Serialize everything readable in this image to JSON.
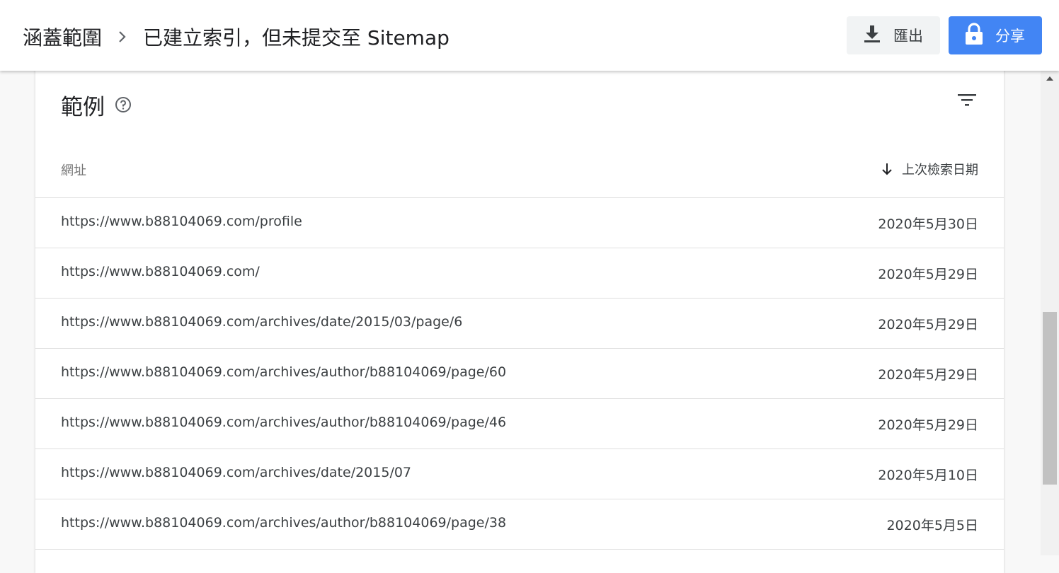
{
  "header": {
    "breadcrumb_parent": "涵蓋範圍",
    "breadcrumb_current": "已建立索引，但未提交至 Sitemap",
    "export_label": "匯出",
    "share_label": "分享",
    "share_color": "#4285f4"
  },
  "card": {
    "title": "範例",
    "columns": {
      "url": "網址",
      "date": "上次檢索日期"
    },
    "rows": [
      {
        "url": "https://www.b88104069.com/profile",
        "date": "2020年5月30日"
      },
      {
        "url": "https://www.b88104069.com/",
        "date": "2020年5月29日"
      },
      {
        "url": "https://www.b88104069.com/archives/date/2015/03/page/6",
        "date": "2020年5月29日"
      },
      {
        "url": "https://www.b88104069.com/archives/author/b88104069/page/60",
        "date": "2020年5月29日"
      },
      {
        "url": "https://www.b88104069.com/archives/author/b88104069/page/46",
        "date": "2020年5月29日"
      },
      {
        "url": "https://www.b88104069.com/archives/date/2015/07",
        "date": "2020年5月10日"
      },
      {
        "url": "https://www.b88104069.com/archives/author/b88104069/page/38",
        "date": "2020年5月5日"
      }
    ]
  },
  "icons": {
    "chevron": "chevron-right-icon",
    "export": "download-icon",
    "share": "lock-icon",
    "help": "help-circle-icon",
    "filter": "filter-icon",
    "sort": "arrow-down-icon"
  }
}
